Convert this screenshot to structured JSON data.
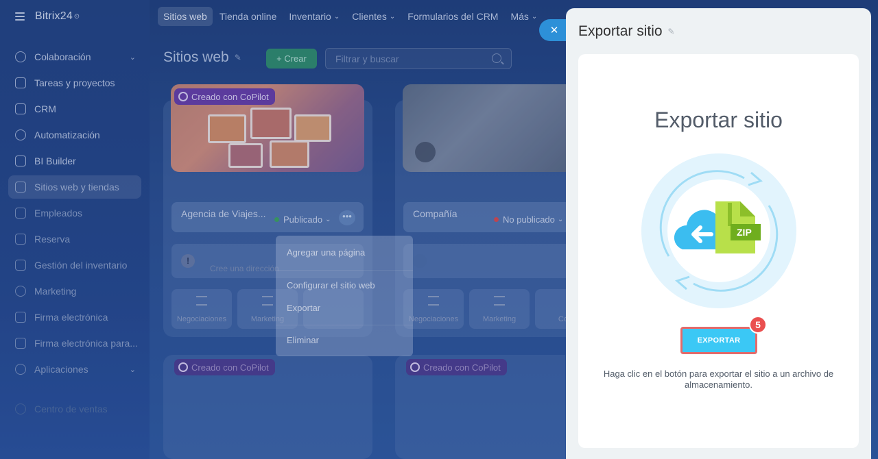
{
  "brand": {
    "name": "Bitrix24",
    "clock": "⏲"
  },
  "sidebar": {
    "items": [
      {
        "label": "Colaboración",
        "icon": "chat-icon",
        "chevron": "⌄"
      },
      {
        "label": "Tareas y proyectos",
        "icon": "checkbox-icon"
      },
      {
        "label": "CRM",
        "icon": "filter-icon"
      },
      {
        "label": "Automatización",
        "icon": "robot-icon"
      },
      {
        "label": "BI Builder",
        "icon": "bar-chart-icon"
      },
      {
        "label": "Sitios web y tiendas",
        "icon": "cart-icon"
      },
      {
        "label": "Empleados",
        "icon": "id-card-icon"
      },
      {
        "label": "Reserva",
        "icon": "calendar-icon"
      },
      {
        "label": "Gestión del inventario",
        "icon": "box-icon"
      },
      {
        "label": "Marketing",
        "icon": "target-icon"
      },
      {
        "label": "Firma electrónica",
        "icon": "pen-icon"
      },
      {
        "label": "Firma electrónica para...",
        "icon": "document-sign-icon"
      },
      {
        "label": "Aplicaciones",
        "icon": "apps-icon",
        "chevron": "⌄"
      },
      {
        "label": "Centro de ventas",
        "icon": "sales-icon"
      }
    ]
  },
  "topbar": {
    "tabs": [
      {
        "label": "Sitios web"
      },
      {
        "label": "Tienda online"
      },
      {
        "label": "Inventario",
        "caret": "⌄"
      },
      {
        "label": "Clientes",
        "caret": "⌄"
      },
      {
        "label": "Formularios del CRM"
      },
      {
        "label": "Más",
        "caret": "⌄"
      }
    ]
  },
  "workspace": {
    "title": "Sitios web",
    "pin": "✎",
    "create_label": "+ Crear",
    "filter_placeholder": "Filtrar y buscar"
  },
  "cards": [
    {
      "badge": "Creado con CoPilot",
      "name": "Agencia de Viajes...",
      "status": "Publicado",
      "status_caret": "⌄",
      "status_color": "#3ea85b",
      "more": "•••",
      "address_warn": "!",
      "address_text": "Cree una dirección",
      "tiles": [
        "Negociaciones",
        "Marketing"
      ]
    },
    {
      "name": "Compañía",
      "status": "No publicado",
      "status_caret": "⌄",
      "status_color": "#e04a4a",
      "tiles": [
        "Negociaciones",
        "Marketing",
        "Coo"
      ]
    }
  ],
  "bottom_cards": [
    {
      "badge": "Creado con CoPilot"
    },
    {
      "badge": "Creado con CoPilot"
    }
  ],
  "context_menu": {
    "items": [
      "Agregar una página",
      "Configurar el sitio web",
      "Exportar",
      "Eliminar"
    ]
  },
  "close_button": "✕",
  "panel": {
    "title": "Exportar sitio",
    "pin": "✎",
    "heading": "Exportar sitio",
    "zip_label": "ZIP",
    "export_label": "EXPORTAR",
    "step_badge": "5",
    "hint": "Haga clic en el botón para exportar el sitio a un archivo de almacenamiento."
  },
  "colors": {
    "accent": "#3bc8f5",
    "highlight_border": "#e46a6a",
    "badge": "#ea4f4f",
    "create_button": "#2f8f6a",
    "zip_green": "#a6d23c"
  }
}
